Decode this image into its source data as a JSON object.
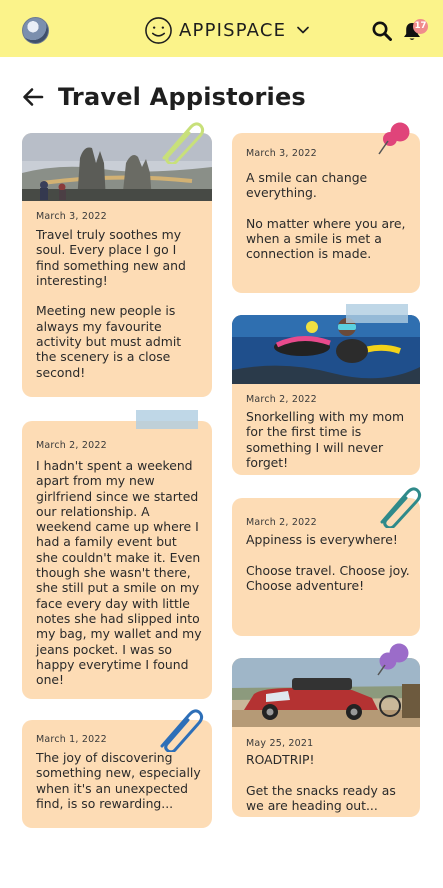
{
  "app": {
    "name": "APPISPACE",
    "notification_count": "17"
  },
  "icons": {
    "avatar": "user-avatar",
    "logo": "smiley-face-icon",
    "caret": "chevron-down-icon",
    "search": "search-icon",
    "bell": "bell-icon",
    "back": "back-arrow-icon",
    "paperclip": "paperclip-icon",
    "pushpin": "pushpin-icon",
    "tape": "tape-strip"
  },
  "colors": {
    "topbar": "#fbf38a",
    "card": "#fddcb5",
    "badge": "#f08c8c",
    "pin_pink": "#e0447a",
    "pin_purple": "#9b6cc9",
    "clip_green": "#c8e07a",
    "clip_teal": "#2f8a8a",
    "clip_blue": "#2d6fb8"
  },
  "page": {
    "title": "Travel Appistories"
  },
  "stories": [
    {
      "date": "March 3, 2022",
      "text": "Travel truly soothes my soul.  Every place I go I find something new and interesting!\n\nMeeting new people is always my favourite activity but must admit the scenery is a close second!",
      "image": "Hands holding a bridge"
    },
    {
      "date": "March 2, 2022",
      "text": "I hadn't spent a weekend apart from my new girlfriend since we started our relationship.  A weekend came up where I had a family event but she couldn't make it.  Even though she wasn't there, she still put a smile on my face every day with little notes she had slipped into my bag, my wallet and my jeans pocket.  I was so happy everytime I found one!"
    },
    {
      "date": "March 1, 2022",
      "text": "The joy of discovering something new, especially when it's an unexpected find, is so rewarding..."
    },
    {
      "date": "March 3, 2022",
      "text": "A smile can change everything.\n\nNo matter where you are, when a smile is met a connection is made."
    },
    {
      "date": "March 2, 2022",
      "text": "Snorkelling with my mom for the first time is something I will never forget!",
      "image": "Snorkelling underwater"
    },
    {
      "date": "March 2, 2022",
      "text": "Appiness is everywhere!\n\nChoose travel. Choose joy. Choose adventure!"
    },
    {
      "date": "May 25, 2021",
      "text": "ROADTRIP!\n\nGet the snacks ready as we are heading out...",
      "image": "Red car loaded for a road trip"
    }
  ]
}
